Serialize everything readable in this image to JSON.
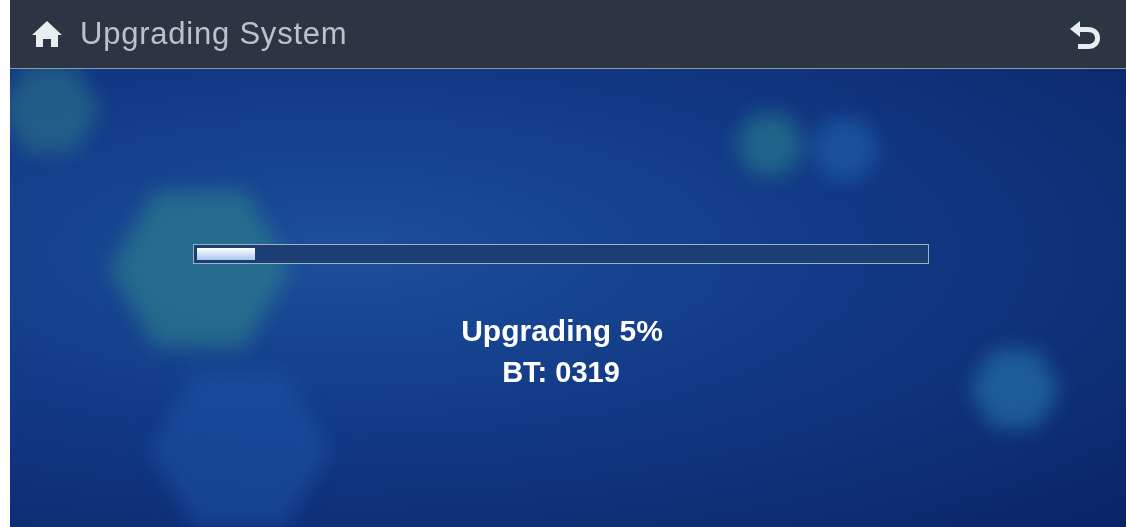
{
  "header": {
    "title": "Upgrading System"
  },
  "progress": {
    "level": 0.08
  },
  "status": {
    "message": "Upgrading 5%",
    "code": "BT: 0319"
  }
}
